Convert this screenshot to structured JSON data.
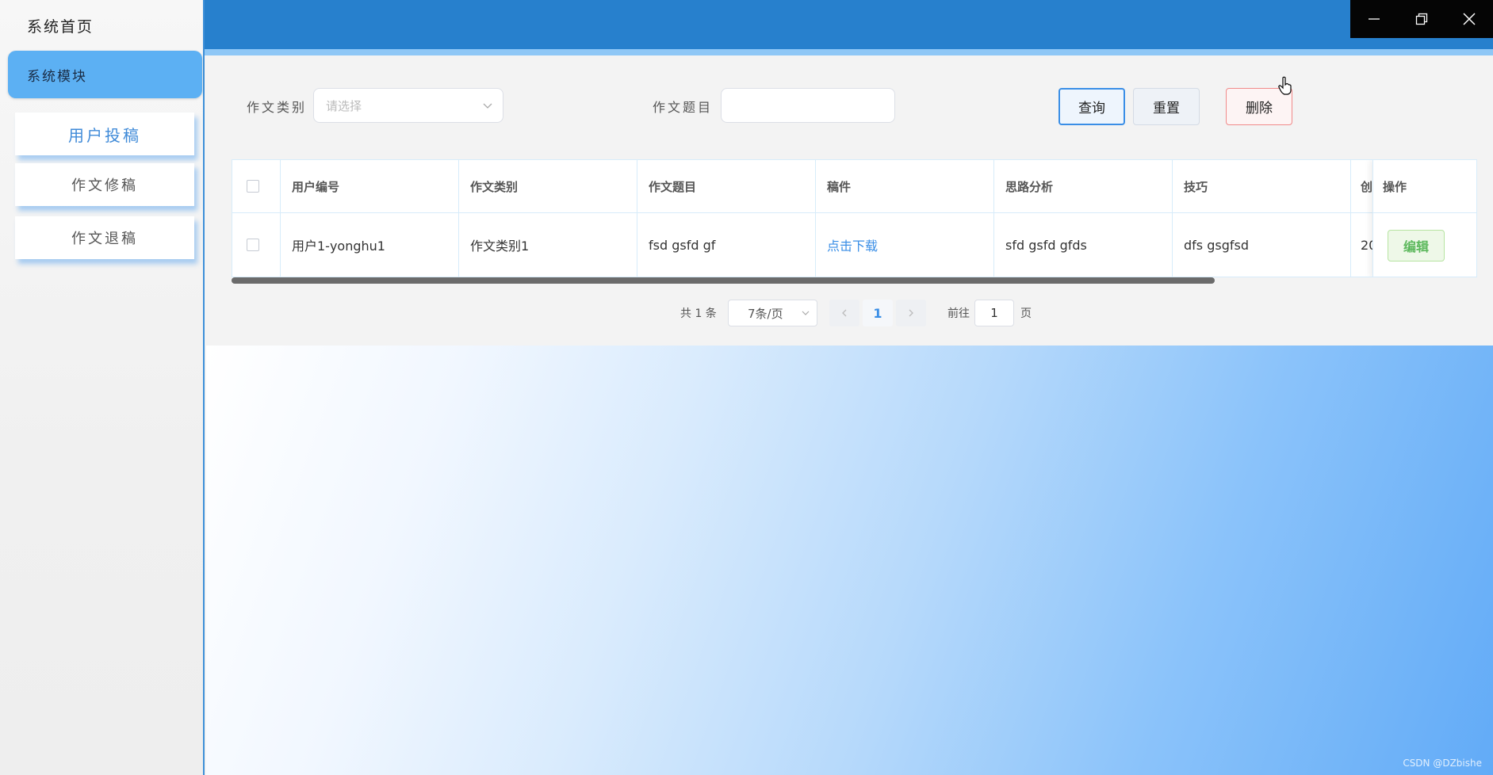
{
  "sidebar": {
    "home": "系统首页",
    "module": "系统模块",
    "items": [
      {
        "label": "用户投稿",
        "active": true
      },
      {
        "label": "作文修稿",
        "active": false
      },
      {
        "label": "作文退稿",
        "active": false
      }
    ]
  },
  "window_controls": [
    "minimize-icon",
    "restore-icon",
    "close-icon"
  ],
  "filters": {
    "category_label": "作文类别",
    "category_placeholder": "请选择",
    "title_label": "作文题目",
    "title_value": ""
  },
  "actions": {
    "query": "查询",
    "reset": "重置",
    "delete": "删除"
  },
  "table": {
    "columns": [
      "用户编号",
      "作文类别",
      "作文题目",
      "稿件",
      "思路分析",
      "技巧",
      "创",
      "操作"
    ],
    "rows": [
      {
        "user_no": "用户1-yonghu1",
        "category": "作文类别1",
        "title": "fsd gsfd gf",
        "manuscript": "点击下载",
        "analysis": "sfd gsfd gfds",
        "skill": "dfs gsgfsd",
        "created": "20",
        "edit": "编辑"
      }
    ]
  },
  "pagination": {
    "total": "共 1 条",
    "page_size": "7条/页",
    "current_page": "1",
    "goto_label": "前往",
    "goto_value": "1",
    "page_suffix": "页"
  },
  "watermark": "CSDN @DZbishe",
  "colors": {
    "topbar": "#2780cd",
    "sidebar_active": "#5cb0f3",
    "primary": "#3a8ee6",
    "danger": "#f08a8a",
    "success": "#5cb85c"
  }
}
